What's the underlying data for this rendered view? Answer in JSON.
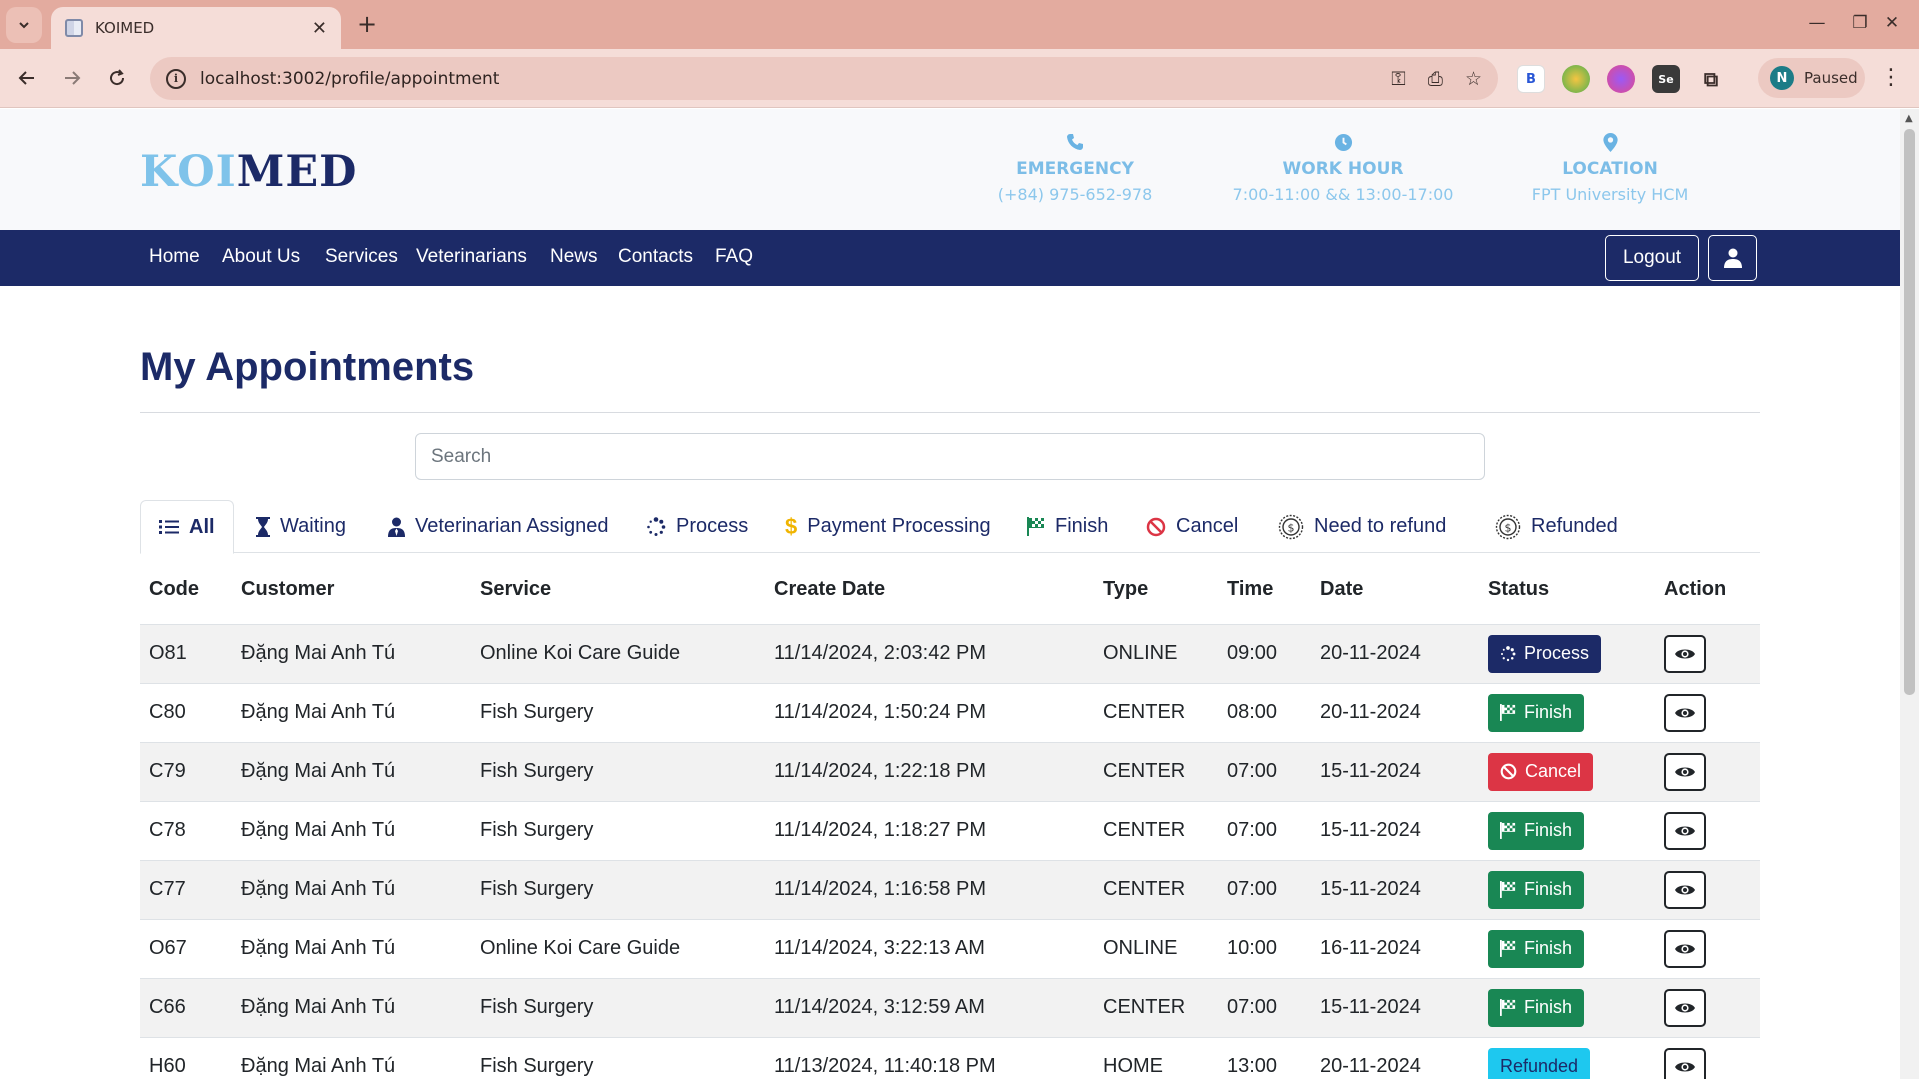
{
  "browser": {
    "tab_title": "KOIMED",
    "url": "localhost:3002/profile/appointment",
    "profile_initial": "N",
    "profile_status": "Paused"
  },
  "header": {
    "logo_part1": "KOI",
    "logo_part2": "MED",
    "emergency": {
      "title": "EMERGENCY",
      "text": "(+84) 975-652-978",
      "icon": "phone-icon"
    },
    "work_hour": {
      "title": "WORK HOUR",
      "text": "7:00-11:00 && 13:00-17:00",
      "icon": "clock-icon"
    },
    "location": {
      "title": "LOCATION",
      "text": "FPT University HCM",
      "icon": "map-pin-icon"
    }
  },
  "nav": {
    "links": [
      "Home",
      "About Us",
      "Services",
      "Veterinarians",
      "News",
      "Contacts",
      "FAQ"
    ],
    "logout": "Logout"
  },
  "page": {
    "title": "My Appointments",
    "search_placeholder": "Search"
  },
  "filter_tabs": [
    {
      "label": "All",
      "icon": "list-icon",
      "active": true
    },
    {
      "label": "Waiting",
      "icon": "hourglass-icon"
    },
    {
      "label": "Veterinarian Assigned",
      "icon": "user-tie-icon"
    },
    {
      "label": "Process",
      "icon": "spinner-icon"
    },
    {
      "label": "Payment Processing",
      "icon": "dollar-icon"
    },
    {
      "label": "Finish",
      "icon": "flag-icon"
    },
    {
      "label": "Cancel",
      "icon": "ban-icon"
    },
    {
      "label": "Need to refund",
      "icon": "coin-icon"
    },
    {
      "label": "Refunded",
      "icon": "coin-icon"
    }
  ],
  "table": {
    "columns": [
      "Code",
      "Customer",
      "Service",
      "Create Date",
      "Type",
      "Time",
      "Date",
      "Status",
      "Action"
    ],
    "rows": [
      {
        "code": "O81",
        "customer": "Đặng Mai Anh Tú",
        "service": "Online Koi Care Guide",
        "created": "11/14/2024, 2:03:42 PM",
        "type": "ONLINE",
        "time": "09:00",
        "date": "20-11-2024",
        "status": "Process"
      },
      {
        "code": "C80",
        "customer": "Đặng Mai Anh Tú",
        "service": "Fish Surgery",
        "created": "11/14/2024, 1:50:24 PM",
        "type": "CENTER",
        "time": "08:00",
        "date": "20-11-2024",
        "status": "Finish"
      },
      {
        "code": "C79",
        "customer": "Đặng Mai Anh Tú",
        "service": "Fish Surgery",
        "created": "11/14/2024, 1:22:18 PM",
        "type": "CENTER",
        "time": "07:00",
        "date": "15-11-2024",
        "status": "Cancel"
      },
      {
        "code": "C78",
        "customer": "Đặng Mai Anh Tú",
        "service": "Fish Surgery",
        "created": "11/14/2024, 1:18:27 PM",
        "type": "CENTER",
        "time": "07:00",
        "date": "15-11-2024",
        "status": "Finish"
      },
      {
        "code": "C77",
        "customer": "Đặng Mai Anh Tú",
        "service": "Fish Surgery",
        "created": "11/14/2024, 1:16:58 PM",
        "type": "CENTER",
        "time": "07:00",
        "date": "15-11-2024",
        "status": "Finish"
      },
      {
        "code": "O67",
        "customer": "Đặng Mai Anh Tú",
        "service": "Online Koi Care Guide",
        "created": "11/14/2024, 3:22:13 AM",
        "type": "ONLINE",
        "time": "10:00",
        "date": "16-11-2024",
        "status": "Finish"
      },
      {
        "code": "C66",
        "customer": "Đặng Mai Anh Tú",
        "service": "Fish Surgery",
        "created": "11/14/2024, 3:12:59 AM",
        "type": "CENTER",
        "time": "07:00",
        "date": "15-11-2024",
        "status": "Finish"
      },
      {
        "code": "H60",
        "customer": "Đặng Mai Anh Tú",
        "service": "Fish Surgery",
        "created": "11/13/2024, 11:40:18 PM",
        "type": "HOME",
        "time": "13:00",
        "date": "20-11-2024",
        "status": "Refunded"
      }
    ]
  },
  "status_colors": {
    "Process": "#1c2a67",
    "Finish": "#198754",
    "Cancel": "#dc3545",
    "Refunded": "#1ec8ef"
  },
  "colors": {
    "brand_navy": "#1c2a67",
    "brand_light": "#7fc3ea",
    "chrome_tabstrip": "#e3ab9f"
  }
}
